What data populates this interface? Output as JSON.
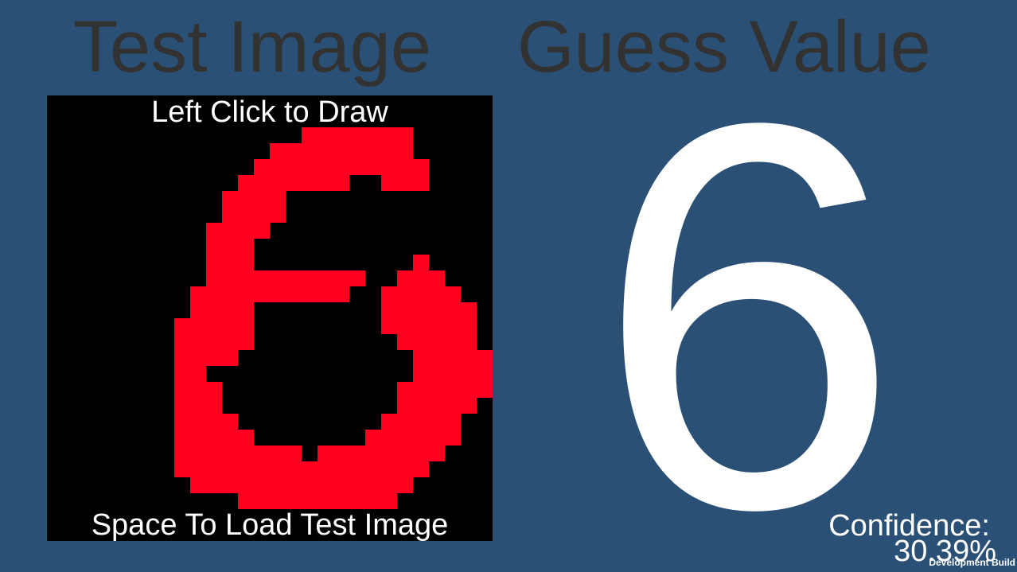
{
  "header": {
    "test_image_title": "Test Image",
    "guess_value_title": "Guess Value"
  },
  "canvas": {
    "top_instruction": "Left Click to Draw",
    "bottom_instruction": "Space To Load Test Image",
    "background_color": "#000000",
    "ink_color": "#ff0020",
    "grid_size": 28,
    "drawn_rows": [
      "............................",
      "............................",
      "................#######.....",
      "..............#########.....",
      ".............###########....",
      "............#######..###....",
      "...........####.............",
      "...........####.............",
      "..........####..............",
      "..........###...............",
      "..........###..........#....",
      "..........##########..###...",
      ".........##########..#####..",
      ".........####........######.",
      "........#####........######.",
      "........#####.........#####.",
      "........####...........#####",
      "........##.............#####",
      "........###...........######",
      "........###...........#####.",
      "........####.........#####..",
      "........#####.......######..",
      "........########.########...",
      "........################....",
      ".........##############.....",
      "............##########......",
      "............................",
      "............................"
    ]
  },
  "result": {
    "guess_digit": "6",
    "confidence_label": "Confidence:",
    "confidence_value": "30.39%"
  },
  "footer": {
    "build_label": "Development Build"
  },
  "colors": {
    "background": "#2b5075",
    "title_text": "#323232",
    "result_text": "#ffffff"
  }
}
